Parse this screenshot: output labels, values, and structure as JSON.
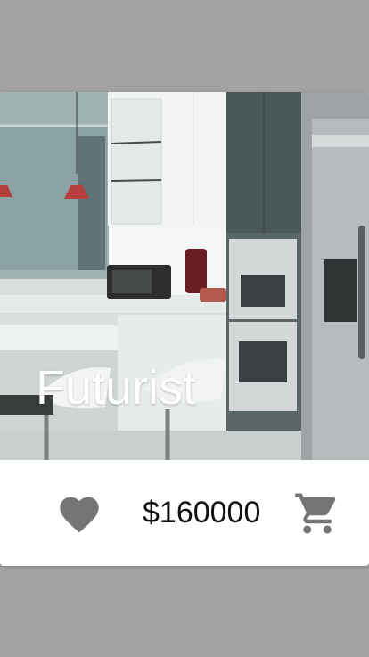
{
  "card": {
    "title": "Futurist",
    "price": "$160000",
    "image_alt": "Modern kitchen"
  },
  "icons": {
    "favorite": "heart-icon",
    "cart": "cart-icon"
  },
  "colors": {
    "background": "#a3a3a3",
    "card": "#ffffff",
    "icon": "#757575",
    "title": "#ffffff"
  }
}
